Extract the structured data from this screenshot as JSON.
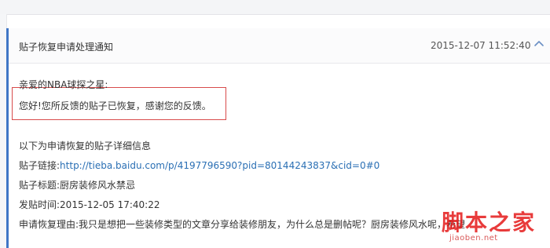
{
  "notice": {
    "title": "贴子恢复申请处理通知",
    "timestamp": "2015-12-07 11:52:40",
    "collapse_icon": "chevron-up-icon"
  },
  "body": {
    "greeting": "亲爱的NBA球探之星:",
    "message": "您好!您所反馈的贴子已恢复，感谢您的反馈。",
    "details_intro": "以下为申请恢复的贴子详细信息",
    "link_label": "贴子链接:",
    "link_url": "http://tieba.baidu.com/p/4197796590?pid=80144243837&cid=0#0",
    "title_label": "贴子标题:",
    "post_title": "厨房装修风水禁忌",
    "time_label": "发贴时间:",
    "post_time": "2015-12-05 17:40:22",
    "reason_label": "申请恢复理由:",
    "reason_text": "我只是想把一些装修类型的文章分享给装修朋友，为什么总是删帖呢？厨房装修风水呢，希望"
  },
  "watermark": {
    "main": "脚本之家",
    "sub": "jiaoben.net"
  },
  "colors": {
    "accent": "#3f76c6",
    "highlight_border": "#d84b4b",
    "link": "#2a6fb4",
    "watermark": "#e51a1a"
  }
}
